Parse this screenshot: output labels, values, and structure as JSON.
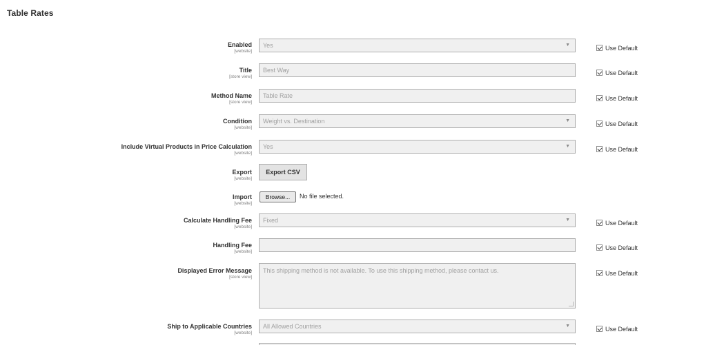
{
  "section": {
    "title": "Table Rates"
  },
  "use_default_label": "Use Default",
  "fields": {
    "enabled": {
      "label": "Enabled",
      "scope": "[website]",
      "value": "Yes"
    },
    "title": {
      "label": "Title",
      "scope": "[store view]",
      "value": "Best Way"
    },
    "method_name": {
      "label": "Method Name",
      "scope": "[store view]",
      "value": "Table Rate"
    },
    "condition": {
      "label": "Condition",
      "scope": "[website]",
      "value": "Weight vs. Destination"
    },
    "include_virtual": {
      "label": "Include Virtual Products in Price Calculation",
      "scope": "[website]",
      "value": "Yes"
    },
    "export": {
      "label": "Export",
      "scope": "[website]",
      "button": "Export CSV"
    },
    "import": {
      "label": "Import",
      "scope": "[website]",
      "button": "Browse...",
      "status": "No file selected."
    },
    "calc_handling_fee": {
      "label": "Calculate Handling Fee",
      "scope": "[website]",
      "value": "Fixed"
    },
    "handling_fee": {
      "label": "Handling Fee",
      "scope": "[website]",
      "value": ""
    },
    "error_message": {
      "label": "Displayed Error Message",
      "scope": "[store view]",
      "value": "This shipping method is not available. To use this shipping method, please contact us."
    },
    "ship_countries": {
      "label": "Ship to Applicable Countries",
      "scope": "[website]",
      "value": "All Allowed Countries"
    }
  },
  "icons": {
    "dropdown": "chevron-down-icon",
    "checkbox": "checkmark-icon"
  }
}
